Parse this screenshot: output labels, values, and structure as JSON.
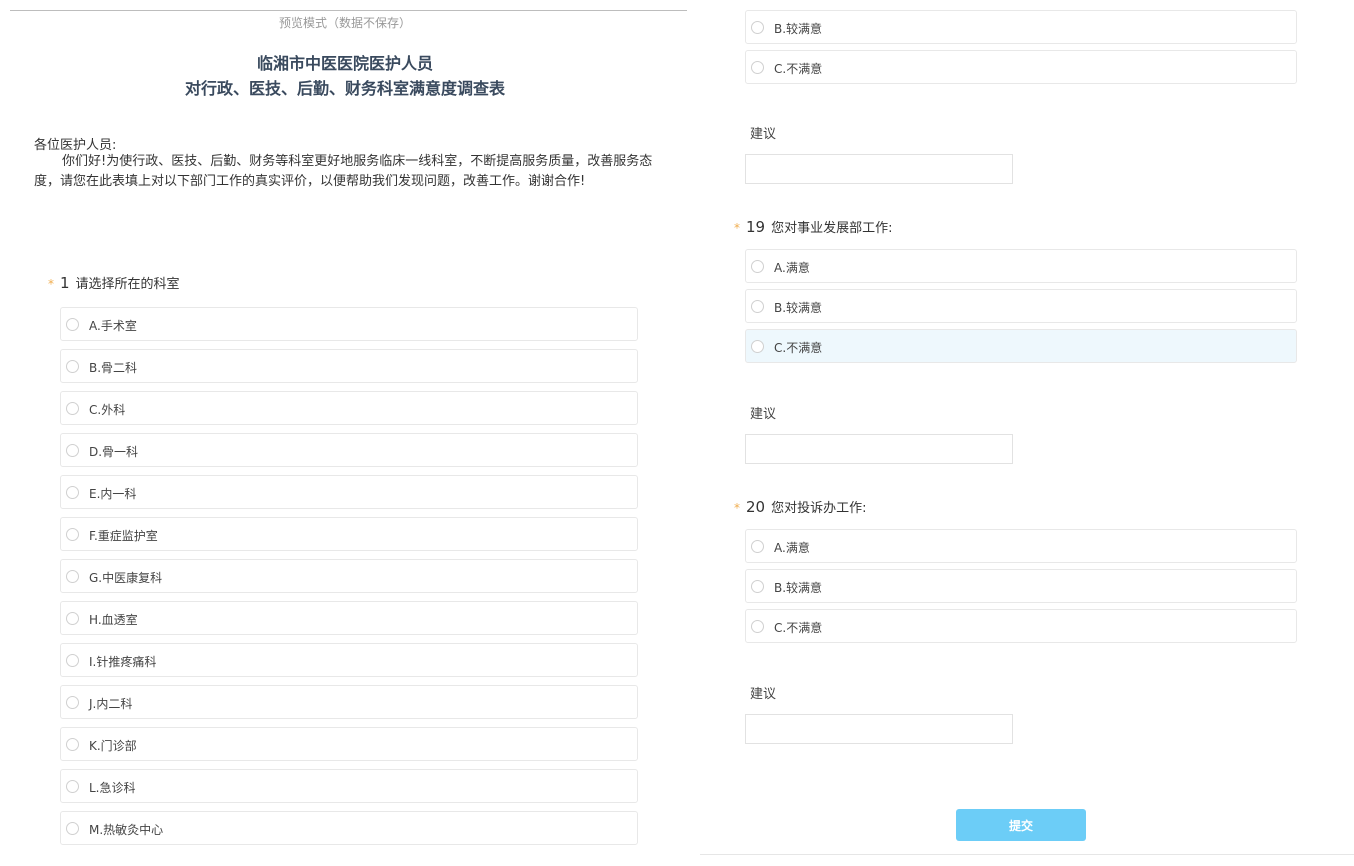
{
  "preview_note": "预览模式（数据不保存）",
  "title_line1": "临湘市中医医院医护人员",
  "title_line2": "对行政、医技、后勤、财务科室满意度调查表",
  "greeting": "各位医护人员:",
  "intro": "你们好!为使行政、医技、后勤、财务等科室更好地服务临床一线科室，不断提高服务质量，改善服务态度，请您在此表填上对以下部门工作的真实评价，以便帮助我们发现问题，改善工作。谢谢合作!",
  "q1": {
    "required_mark": "*",
    "number": "1",
    "text": "请选择所在的科室",
    "options": [
      "A.手术室",
      "B.骨二科",
      "C.外科",
      "D.骨一科",
      "E.内一科",
      "F.重症监护室",
      "G.中医康复科",
      "H.血透室",
      "I.针推疼痛科",
      "J.内二科",
      "K.门诊部",
      "L.急诊科",
      "M.热敏灸中心"
    ]
  },
  "q18_partial": {
    "options": [
      "B.较满意",
      "C.不满意"
    ],
    "suggest_label": "建议",
    "suggest_value": ""
  },
  "q19": {
    "required_mark": "*",
    "number": "19",
    "text": "您对事业发展部工作:",
    "options": [
      "A.满意",
      "B.较满意",
      "C.不满意"
    ],
    "suggest_label": "建议",
    "suggest_value": ""
  },
  "q20": {
    "required_mark": "*",
    "number": "20",
    "text": "您对投诉办工作:",
    "options": [
      "A.满意",
      "B.较满意",
      "C.不满意"
    ],
    "suggest_label": "建议",
    "suggest_value": ""
  },
  "submit_label": "提交",
  "colors": {
    "accent": "#6ccdf7",
    "required_star": "#f0ad4e",
    "title": "#3a4a5e",
    "hover_row": "#eef8fd"
  }
}
